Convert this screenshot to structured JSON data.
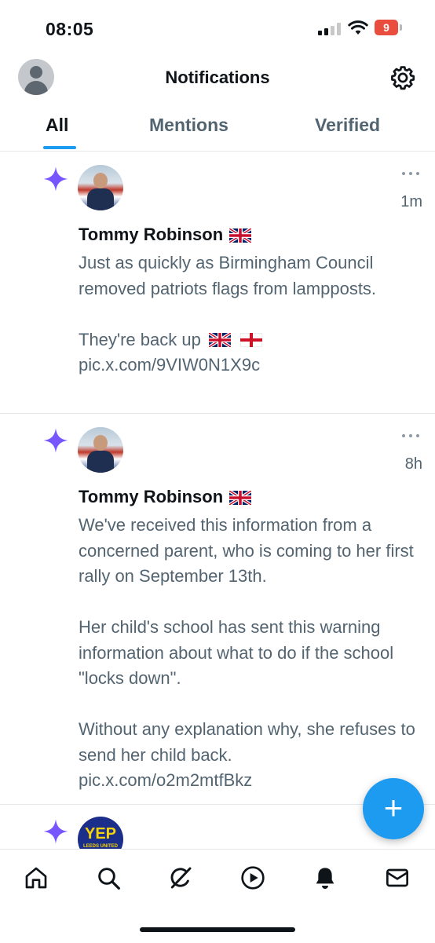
{
  "status": {
    "time": "08:05",
    "battery": "9"
  },
  "header": {
    "title": "Notifications",
    "avatar_icon": "default-profile-icon",
    "settings_icon": "gear-icon"
  },
  "tabs": [
    {
      "label": "All",
      "active": true
    },
    {
      "label": "Mentions",
      "active": false
    },
    {
      "label": "Verified",
      "active": false
    }
  ],
  "notifications": [
    {
      "icon": "sparkle-icon",
      "name": "Tommy Robinson",
      "time": "1m",
      "text": "Just as quickly as Birmingham Council removed patriots flags from lampposts.\n\nThey're back up",
      "link": " pic.x.com/9VIW0N1X9c"
    },
    {
      "icon": "sparkle-icon",
      "name": "Tommy Robinson",
      "time": "8h",
      "text": "We've received this information from a concerned parent, who is coming to her first rally on September 13th.\n\nHer child's school has sent this warning information about what to do if the school \"locks down\".\n\nWithout any explanation why, she refuses to send her child back.\npic.x.com/o2m2mtfBkz"
    },
    {
      "icon": "sparkle-icon",
      "avatar_text": "YEP",
      "avatar_subtext": "LEEDS UNITED"
    }
  ],
  "fab": {
    "label": "+"
  },
  "colors": {
    "accent": "#1d9bf0",
    "sparkle": "#7856ff",
    "text": "#0f1419",
    "secondary": "#536471"
  },
  "tabbar": [
    "home-icon",
    "search-icon",
    "grok-icon",
    "video-icon",
    "bell-icon",
    "mail-icon"
  ]
}
